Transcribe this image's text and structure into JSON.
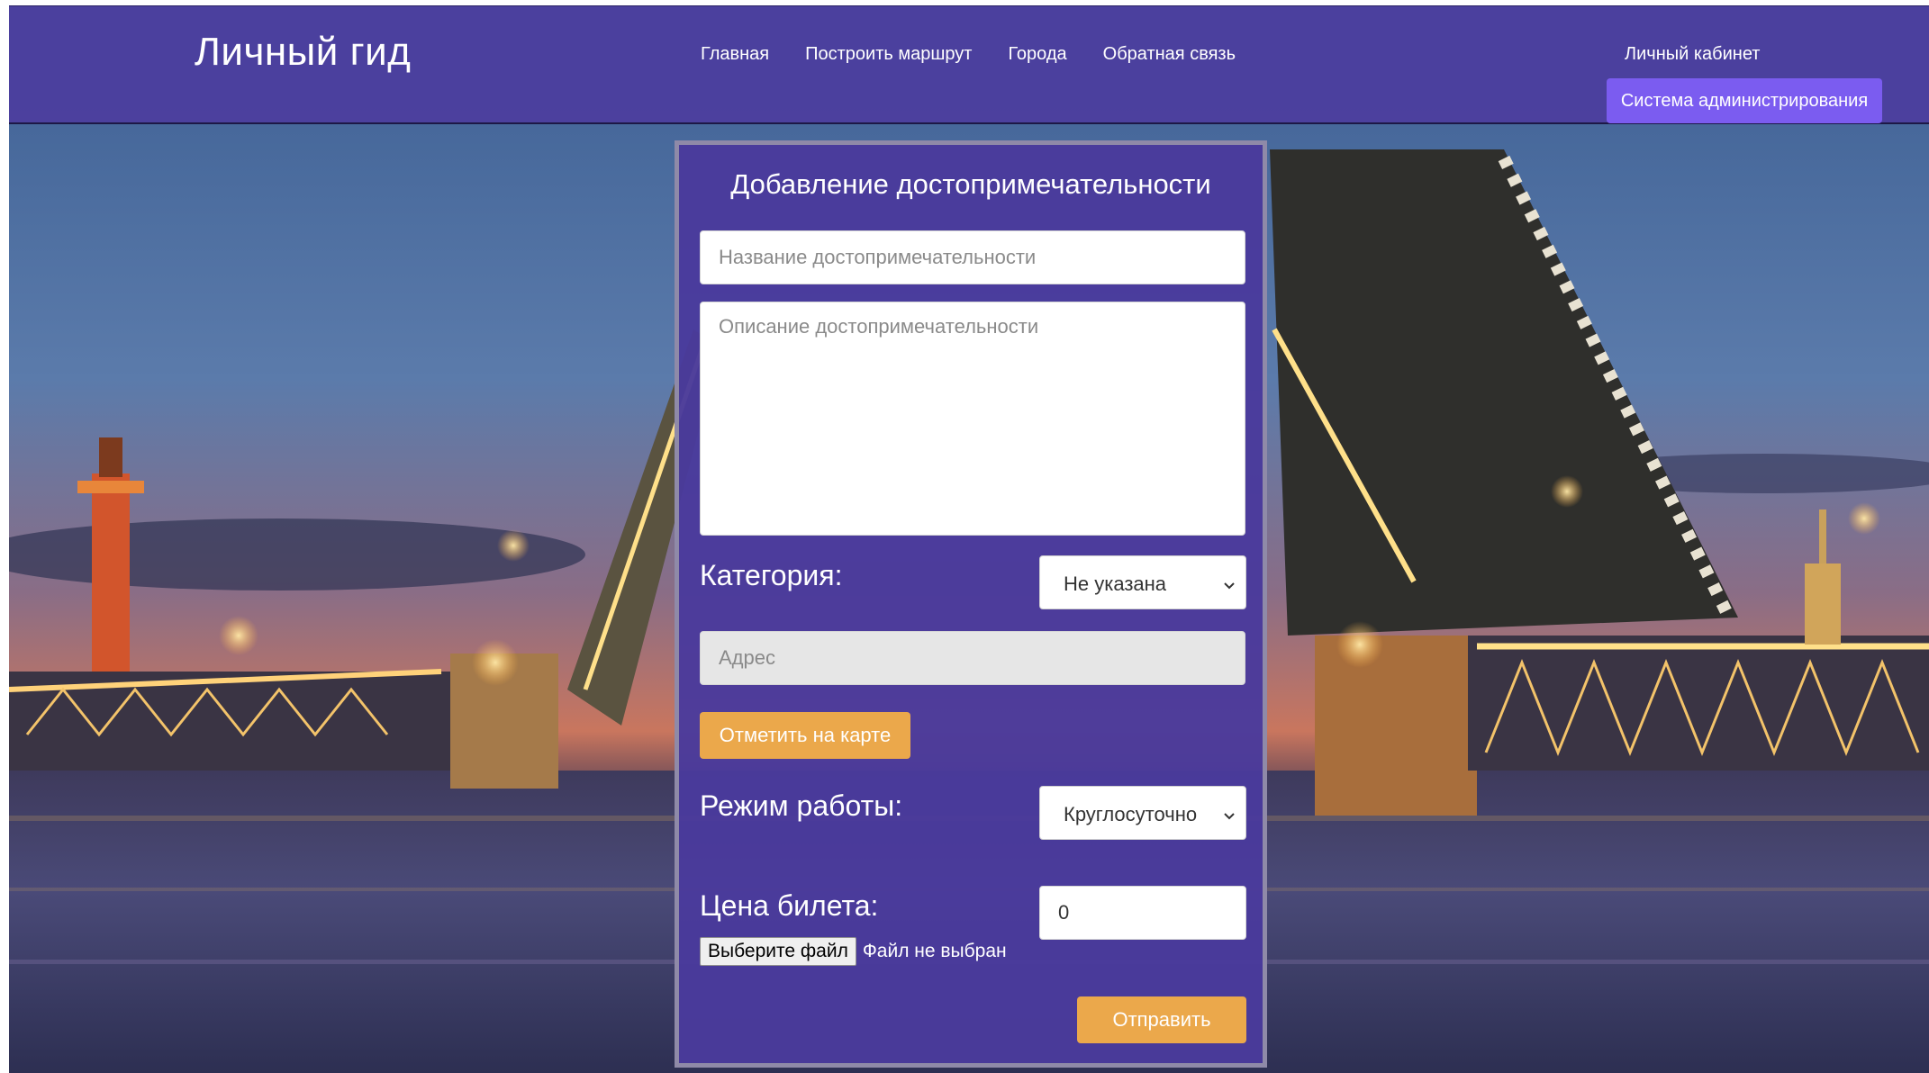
{
  "header": {
    "brand": "Личный гид",
    "nav": [
      {
        "label": "Главная"
      },
      {
        "label": "Построить маршрут"
      },
      {
        "label": "Города"
      },
      {
        "label": "Обратная связь"
      }
    ],
    "cabinet": "Личный кабинет",
    "admin_button": "Система администрирования"
  },
  "form": {
    "title": "Добавление достопримечательности",
    "name_placeholder": "Название достопримечательности",
    "description_placeholder": "Описание достопримечательности",
    "category_label": "Категория:",
    "category_value": "Не указана",
    "address_placeholder": "Адрес",
    "map_button": "Отметить на карте",
    "hours_label": "Режим работы:",
    "hours_value": "Круглосуточно",
    "price_label": "Цена билета:",
    "price_value": "0",
    "file_button": "Выберите файл",
    "file_status": "Файл не выбран",
    "submit_button": "Отправить"
  },
  "colors": {
    "header_bg": "#4c3e9e",
    "panel_bg": "#4a3a9c",
    "accent_orange": "#eba84b",
    "admin_button_bg": "#7b5cf0"
  },
  "icons": {
    "select_chevron": "chevron-down-icon"
  }
}
